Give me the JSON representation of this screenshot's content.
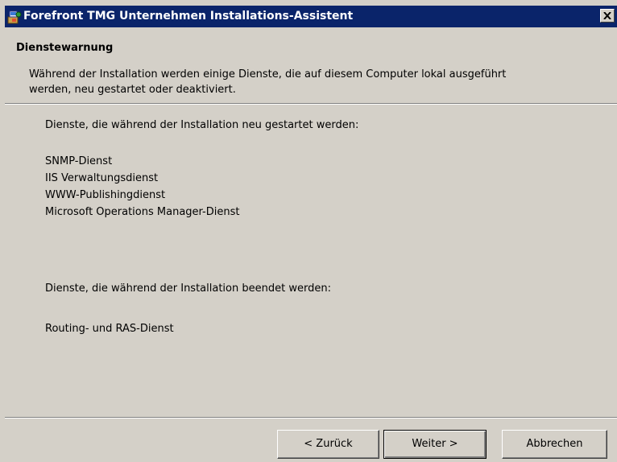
{
  "window": {
    "title": "Forefront TMG Unternehmen Installations-Assistent",
    "icon": "installer-icon",
    "close_label": "×"
  },
  "header": {
    "title": "Dienstewarnung",
    "description": "Während der Installation werden einige Dienste, die auf diesem Computer lokal ausgeführt werden, neu gestartet oder deaktiviert."
  },
  "content": {
    "restarted_heading": "Dienste, die während der Installation neu gestartet werden:",
    "restarted_services": [
      "SNMP-Dienst",
      "IIS Verwaltungsdienst",
      "WWW-Publishingdienst",
      "Microsoft Operations Manager-Dienst"
    ],
    "stopped_heading": "Dienste, die während der Installation beendet werden:",
    "stopped_services": [
      "Routing- und RAS-Dienst"
    ]
  },
  "buttons": {
    "back": "< Zurück",
    "next": "Weiter >",
    "cancel": "Abbrechen"
  },
  "colors": {
    "titlebar": "#0a246a",
    "face": "#d4d0c8"
  }
}
